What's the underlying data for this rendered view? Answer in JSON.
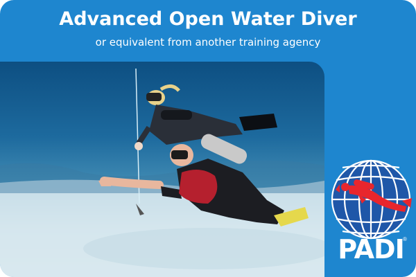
{
  "card": {
    "title": "Advanced Open Water Diver",
    "subtitle": "or equivalent from another training agency"
  },
  "photo": {
    "scene": "underwater-divers-photo"
  },
  "logo": {
    "wordmark": "PADI",
    "registered_mark": "®",
    "colors": {
      "globe": "#1f57a8",
      "diver": "#e8262d",
      "background": "#1e86cf"
    }
  }
}
